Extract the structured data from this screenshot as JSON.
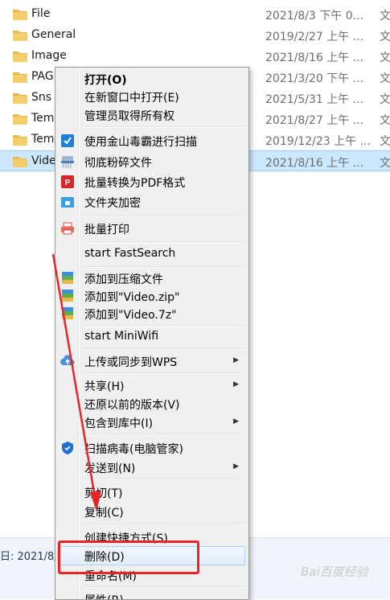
{
  "files": [
    {
      "name": "File",
      "date": "2021/8/3 下午 0...",
      "type": "文"
    },
    {
      "name": "General",
      "date": "2019/2/27 上午 ...",
      "type": "文"
    },
    {
      "name": "Image",
      "date": "2021/8/16 上午 ...",
      "type": "文"
    },
    {
      "name": "PAG",
      "date": "2021/3/20 下午 ...",
      "type": "文"
    },
    {
      "name": "Sns",
      "date": "2021/5/31 上午 ...",
      "type": "文"
    },
    {
      "name": "Tem",
      "date": "2021/8/27 上午 ...",
      "type": "文"
    },
    {
      "name": "Tem",
      "date": "2019/12/23 上午 ...",
      "type": "文"
    },
    {
      "name": "Vide",
      "date": "2021/8/16 上午 ...",
      "type": "文"
    }
  ],
  "status": {
    "text": "日: 2021/8/"
  },
  "menu": {
    "open": "打开(O)",
    "open_new_window": "在新窗口中打开(E)",
    "take_ownership": "管理员取得所有权",
    "scan_kingsoft": "使用金山毒霸进行扫描",
    "shred": "彻底粉碎文件",
    "to_pdf": "批量转换为PDF格式",
    "encrypt": "文件夹加密",
    "batch_print": "批量打印",
    "fastsearch": "start FastSearch",
    "add_archive": "添加到压缩文件",
    "add_zip": "添加到\"Video.zip\"",
    "add_7z": "添加到\"Video.7z\"",
    "miniwifi": "start MiniWifi",
    "wps_sync": "上传或同步到WPS",
    "share": "共享(H)",
    "restore": "还原以前的版本(V)",
    "include_library": "包含到库中(I)",
    "scan_virus": "扫描病毒(电脑管家)",
    "send_to": "发送到(N)",
    "cut": "剪切(T)",
    "copy": "复制(C)",
    "create_shortcut": "创建快捷方式(S)",
    "delete": "删除(D)",
    "rename": "重命名(M)",
    "properties": "属性(R)"
  },
  "watermark": "Bai百度经验",
  "colors": {
    "accent_red": "#e8262a",
    "selection": "#cce8ff",
    "folder": "#e8b84a"
  }
}
